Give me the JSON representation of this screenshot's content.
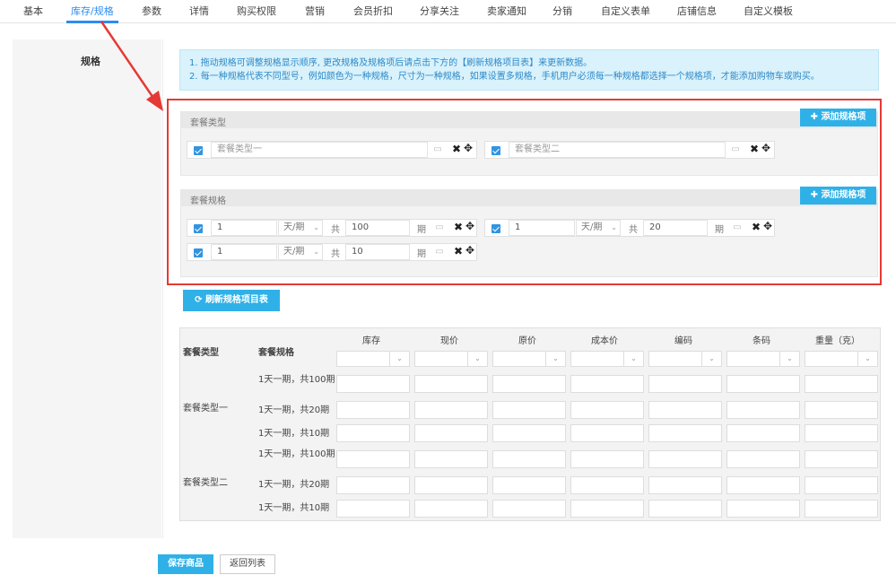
{
  "tabs": [
    "基本",
    "库存/规格",
    "参数",
    "详情",
    "购买权限",
    "营销",
    "会员折扣",
    "分享关注",
    "卖家通知",
    "分销",
    "自定义表单",
    "店铺信息",
    "自定义模板"
  ],
  "label": "规格",
  "tip": {
    "line1": "1. 拖动规格可调整规格显示顺序, 更改规格及规格项后请点击下方的【刷新规格项目表】来更新数据。",
    "line2": "2. 每一种规格代表不同型号，例如颜色为一种规格，尺寸为一种规格，如果设置多规格，手机用户必须每一种规格都选择一个规格项，才能添加购物车或购买。"
  },
  "add_label": "添加规格项",
  "group1": {
    "title": "套餐类型",
    "items": [
      {
        "value": "套餐类型一"
      },
      {
        "value": "套餐类型二"
      }
    ]
  },
  "group2": {
    "title": "套餐规格",
    "unit_select": "天/期",
    "gong": "共",
    "qi": "期",
    "items": [
      {
        "num": "1",
        "total": "100"
      },
      {
        "num": "1",
        "total": "20"
      },
      {
        "num": "1",
        "total": "10"
      }
    ]
  },
  "refresh_label": "刷新规格项目表",
  "table": {
    "col_type": "套餐类型",
    "col_spec": "套餐规格",
    "cols": [
      "库存",
      "现价",
      "原价",
      "成本价",
      "编码",
      "条码",
      "重量（克）"
    ],
    "groups": [
      "套餐类型一",
      "套餐类型二"
    ],
    "rows": [
      "1天一期，共100期",
      "1天一期，共20期",
      "1天一期，共10期",
      "1天一期，共100期",
      "1天一期，共20期",
      "1天一期，共10期"
    ]
  },
  "save_label": "保存商品",
  "back_label": "返回列表"
}
